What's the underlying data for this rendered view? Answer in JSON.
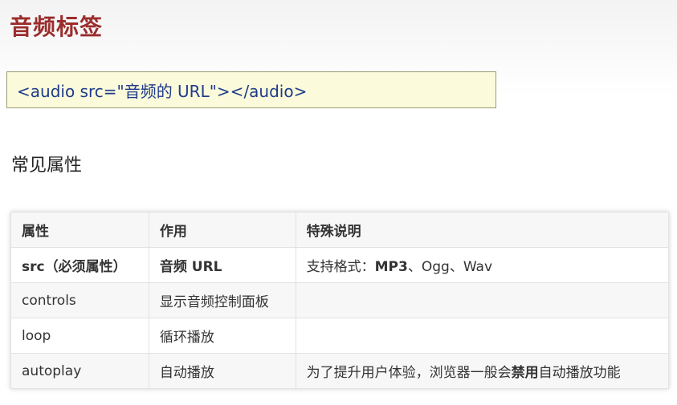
{
  "page": {
    "title": "音频标签"
  },
  "code": {
    "text": "<audio src=\"音频的 URL\"></audio>"
  },
  "section": {
    "title": "常见属性"
  },
  "table": {
    "headers": [
      "属性",
      "作用",
      "特殊说明"
    ],
    "rows": [
      {
        "attr": "src（必须属性）",
        "use": "音频 URL",
        "note_before": "支持格式：",
        "note_strong": "MP3",
        "note_after": "、Ogg、Wav"
      },
      {
        "attr": "controls",
        "use": "显示音频控制面板",
        "note_before": "",
        "note_strong": "",
        "note_after": ""
      },
      {
        "attr": "loop",
        "use": "循环播放",
        "note_before": "",
        "note_strong": "",
        "note_after": ""
      },
      {
        "attr": "autoplay",
        "use": "自动播放",
        "note_before": "为了提升用户体验，浏览器一般会",
        "note_strong": "禁用",
        "note_after": "自动播放功能"
      }
    ]
  }
}
